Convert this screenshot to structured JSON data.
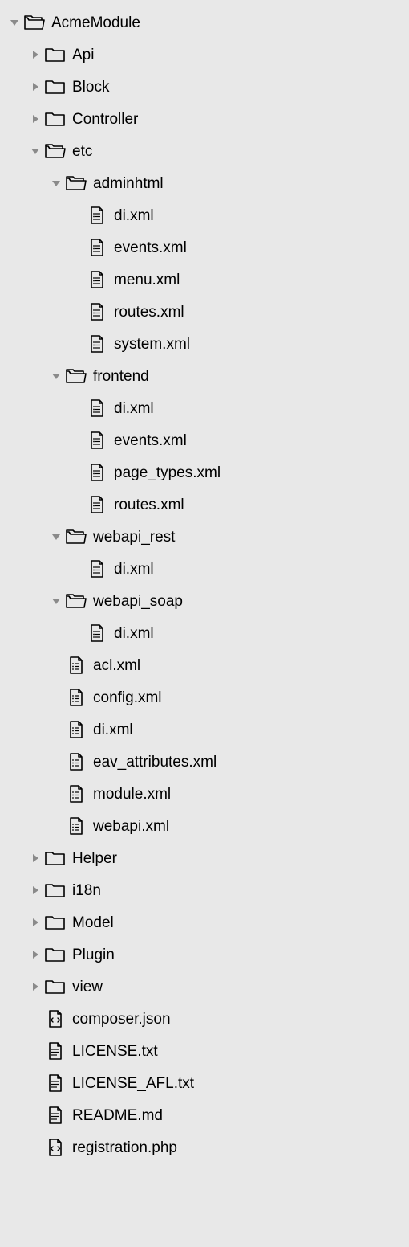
{
  "tree": [
    {
      "depth": 0,
      "type": "folder",
      "expanded": true,
      "label": "AcmeModule"
    },
    {
      "depth": 1,
      "type": "folder",
      "expanded": false,
      "label": "Api"
    },
    {
      "depth": 1,
      "type": "folder",
      "expanded": false,
      "label": "Block"
    },
    {
      "depth": 1,
      "type": "folder",
      "expanded": false,
      "label": "Controller"
    },
    {
      "depth": 1,
      "type": "folder",
      "expanded": true,
      "label": "etc"
    },
    {
      "depth": 2,
      "type": "folder",
      "expanded": true,
      "label": "adminhtml"
    },
    {
      "depth": 3,
      "type": "file",
      "kind": "xml",
      "label": "di.xml"
    },
    {
      "depth": 3,
      "type": "file",
      "kind": "xml",
      "label": "events.xml"
    },
    {
      "depth": 3,
      "type": "file",
      "kind": "xml",
      "label": "menu.xml"
    },
    {
      "depth": 3,
      "type": "file",
      "kind": "xml",
      "label": "routes.xml"
    },
    {
      "depth": 3,
      "type": "file",
      "kind": "xml",
      "label": "system.xml"
    },
    {
      "depth": 2,
      "type": "folder",
      "expanded": true,
      "label": "frontend"
    },
    {
      "depth": 3,
      "type": "file",
      "kind": "xml",
      "label": "di.xml"
    },
    {
      "depth": 3,
      "type": "file",
      "kind": "xml",
      "label": "events.xml"
    },
    {
      "depth": 3,
      "type": "file",
      "kind": "xml",
      "label": "page_types.xml"
    },
    {
      "depth": 3,
      "type": "file",
      "kind": "xml",
      "label": "routes.xml"
    },
    {
      "depth": 2,
      "type": "folder",
      "expanded": true,
      "label": "webapi_rest"
    },
    {
      "depth": 3,
      "type": "file",
      "kind": "xml",
      "label": "di.xml"
    },
    {
      "depth": 2,
      "type": "folder",
      "expanded": true,
      "label": "webapi_soap"
    },
    {
      "depth": 3,
      "type": "file",
      "kind": "xml",
      "label": "di.xml"
    },
    {
      "depth": 2,
      "type": "file",
      "kind": "xml",
      "label": "acl.xml"
    },
    {
      "depth": 2,
      "type": "file",
      "kind": "xml",
      "label": "config.xml"
    },
    {
      "depth": 2,
      "type": "file",
      "kind": "xml",
      "label": "di.xml"
    },
    {
      "depth": 2,
      "type": "file",
      "kind": "xml",
      "label": "eav_attributes.xml"
    },
    {
      "depth": 2,
      "type": "file",
      "kind": "xml",
      "label": "module.xml"
    },
    {
      "depth": 2,
      "type": "file",
      "kind": "xml",
      "label": "webapi.xml"
    },
    {
      "depth": 1,
      "type": "folder",
      "expanded": false,
      "label": "Helper"
    },
    {
      "depth": 1,
      "type": "folder",
      "expanded": false,
      "label": "i18n"
    },
    {
      "depth": 1,
      "type": "folder",
      "expanded": false,
      "label": "Model"
    },
    {
      "depth": 1,
      "type": "folder",
      "expanded": false,
      "label": "Plugin"
    },
    {
      "depth": 1,
      "type": "folder",
      "expanded": false,
      "label": "view"
    },
    {
      "depth": 1,
      "type": "file",
      "kind": "code",
      "label": "composer.json"
    },
    {
      "depth": 1,
      "type": "file",
      "kind": "text",
      "label": "LICENSE.txt"
    },
    {
      "depth": 1,
      "type": "file",
      "kind": "text",
      "label": "LICENSE_AFL.txt"
    },
    {
      "depth": 1,
      "type": "file",
      "kind": "text",
      "label": "README.md"
    },
    {
      "depth": 1,
      "type": "file",
      "kind": "code",
      "label": "registration.php"
    }
  ]
}
